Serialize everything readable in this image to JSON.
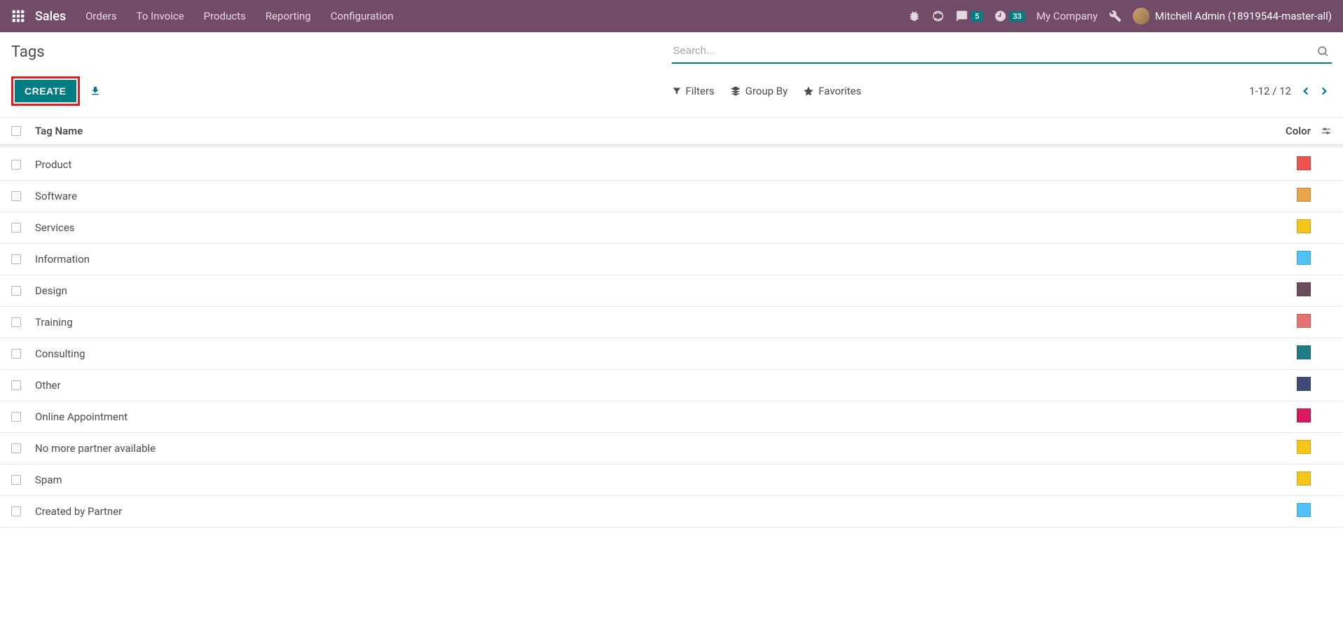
{
  "navbar": {
    "brand": "Sales",
    "menu": [
      "Orders",
      "To Invoice",
      "Products",
      "Reporting",
      "Configuration"
    ],
    "chat_badge": "5",
    "activity_badge": "33",
    "company": "My Company",
    "username": "Mitchell Admin (18919544-master-all)"
  },
  "page": {
    "title": "Tags",
    "create_label": "CREATE",
    "search_placeholder": "Search..."
  },
  "search_panel": {
    "filters": "Filters",
    "group_by": "Group By",
    "favorites": "Favorites"
  },
  "pager": {
    "range": "1-12",
    "sep": "/",
    "total": "12"
  },
  "table": {
    "col_name": "Tag Name",
    "col_color": "Color",
    "rows": [
      {
        "name": "Product",
        "color": "#EF5350"
      },
      {
        "name": "Software",
        "color": "#E8A54C"
      },
      {
        "name": "Services",
        "color": "#F5C518"
      },
      {
        "name": "Information",
        "color": "#4FC3F7"
      },
      {
        "name": "Design",
        "color": "#6B4C5B"
      },
      {
        "name": "Training",
        "color": "#E57373"
      },
      {
        "name": "Consulting",
        "color": "#1F7D87"
      },
      {
        "name": "Other",
        "color": "#3F4A7A"
      },
      {
        "name": "Online Appointment",
        "color": "#D81B60"
      },
      {
        "name": "No more partner available",
        "color": "#F5C518"
      },
      {
        "name": "Spam",
        "color": "#F5C518"
      },
      {
        "name": "Created by Partner",
        "color": "#4FC3F7"
      }
    ]
  }
}
